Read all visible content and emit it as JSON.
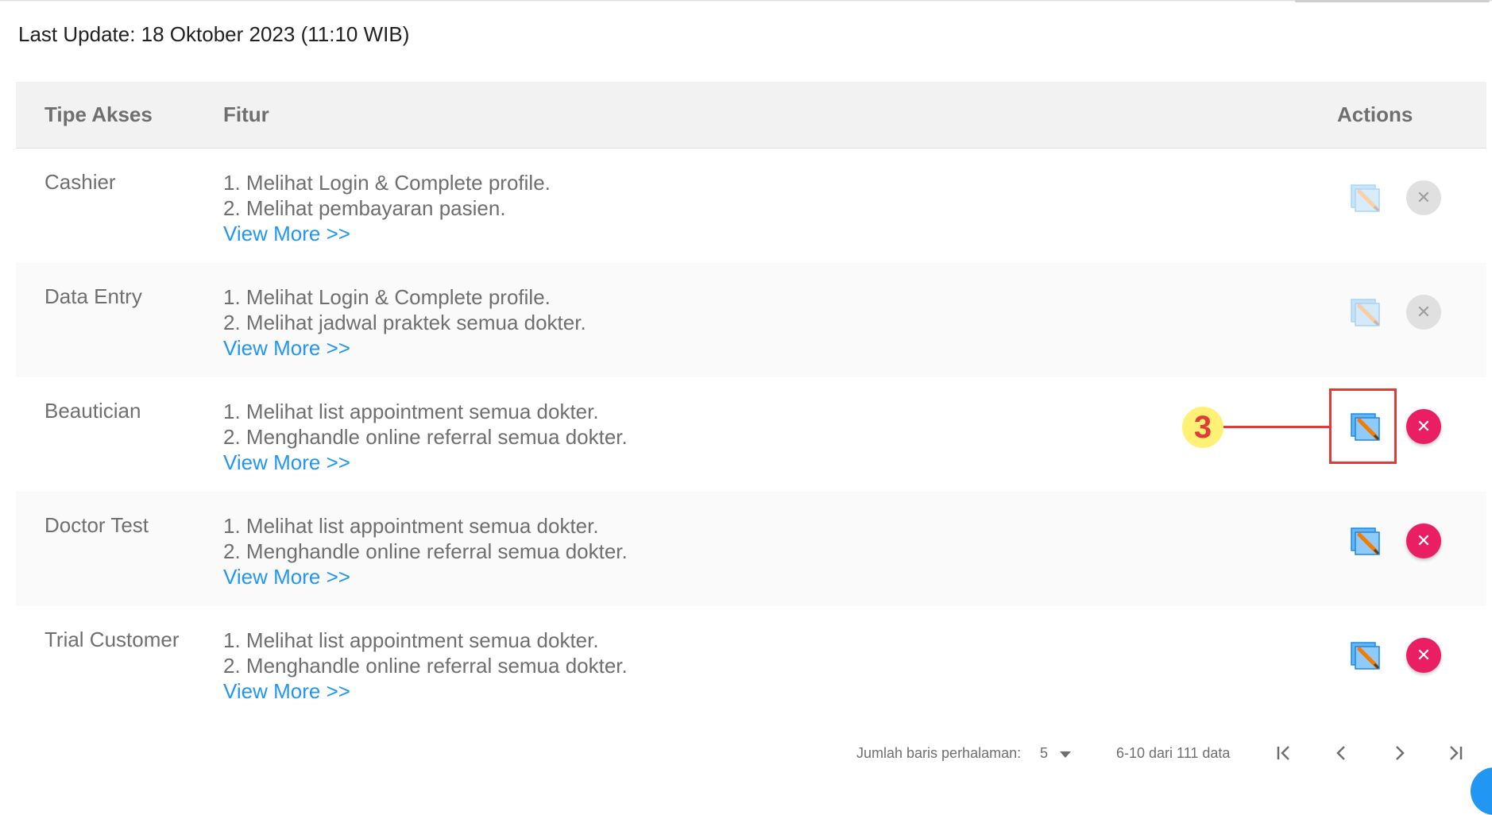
{
  "last_update": "Last Update: 18 Oktober 2023 (11:10 WIB)",
  "table": {
    "headers": {
      "tipe": "Tipe Akses",
      "fitur": "Fitur",
      "actions": "Actions"
    },
    "rows": [
      {
        "tipe": "Cashier",
        "line1": "1. Melihat Login & Complete profile.",
        "line2": "2. Melihat pembayaran pasien.",
        "view_more": "View More >>",
        "actions_enabled": false
      },
      {
        "tipe": "Data Entry",
        "line1": "1. Melihat Login & Complete profile.",
        "line2": "2. Melihat jadwal praktek semua dokter.",
        "view_more": "View More >>",
        "actions_enabled": false
      },
      {
        "tipe": "Beautician",
        "line1": "1. Melihat list appointment semua dokter.",
        "line2": "2. Menghandle online referral semua dokter.",
        "view_more": "View More >>",
        "actions_enabled": true
      },
      {
        "tipe": "Doctor Test",
        "line1": "1. Melihat list appointment semua dokter.",
        "line2": "2. Menghandle online referral semua dokter.",
        "view_more": "View More >>",
        "actions_enabled": true
      },
      {
        "tipe": "Trial Customer",
        "line1": "1. Melihat list appointment semua dokter.",
        "line2": "2. Menghandle online referral semua dokter.",
        "view_more": "View More >>",
        "actions_enabled": true
      }
    ]
  },
  "annotation": {
    "number": "3"
  },
  "pagination": {
    "rows_label": "Jumlah baris perhalaman:",
    "rows_value": "5",
    "range": "6-10 dari 111 data"
  },
  "colors": {
    "accent": "#2196f3",
    "delete": "#e91e63",
    "annotation": "#e53935",
    "badge": "#fff176"
  },
  "icons": {
    "edit": "edit-icon",
    "delete": "close-icon",
    "first": "first-page-icon",
    "prev": "chevron-left-icon",
    "next": "chevron-right-icon",
    "last": "last-page-icon"
  }
}
